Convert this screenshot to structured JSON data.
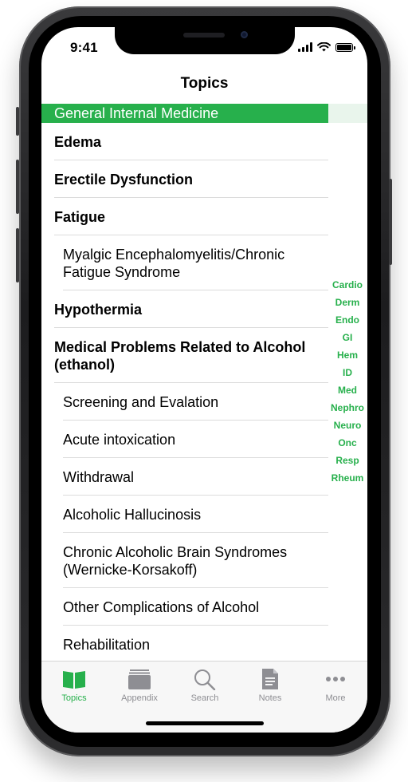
{
  "status_bar": {
    "time": "9:41"
  },
  "nav": {
    "title": "Topics"
  },
  "section": {
    "header": "General Internal Medicine"
  },
  "rows": [
    {
      "label": "Edema",
      "style": "bold"
    },
    {
      "label": "Erectile Dysfunction",
      "style": "bold"
    },
    {
      "label": "Fatigue",
      "style": "bold"
    },
    {
      "label": "Myalgic Encephalomyelitis/Chronic Fatigue Syndrome",
      "style": "sub"
    },
    {
      "label": "Hypothermia",
      "style": "bold"
    },
    {
      "label": "Medical Problems Related to Alcohol (ethanol)",
      "style": "bold"
    },
    {
      "label": "Screening and Evalation",
      "style": "sub"
    },
    {
      "label": "Acute intoxication",
      "style": "sub"
    },
    {
      "label": "Withdrawal",
      "style": "sub"
    },
    {
      "label": "Alcoholic Hallucinosis",
      "style": "sub"
    },
    {
      "label": "Chronic Alcoholic Brain Syndromes (Wernicke-Korsakoff)",
      "style": "sub"
    },
    {
      "label": "Other Complications of Alcohol",
      "style": "sub"
    },
    {
      "label": "Rehabilitation",
      "style": "sub"
    }
  ],
  "index": [
    "Cardio",
    "Derm",
    "Endo",
    "GI",
    "Hem",
    "ID",
    "Med",
    "Nephro",
    "Neuro",
    "Onc",
    "Resp",
    "Rheum"
  ],
  "tabs": [
    {
      "label": "Topics",
      "icon": "open-book-icon",
      "active": true
    },
    {
      "label": "Appendix",
      "icon": "archive-box-icon",
      "active": false
    },
    {
      "label": "Search",
      "icon": "magnifier-icon",
      "active": false
    },
    {
      "label": "Notes",
      "icon": "note-document-icon",
      "active": false
    },
    {
      "label": "More",
      "icon": "ellipsis-icon",
      "active": false
    }
  ],
  "colors": {
    "accent": "#27b04c",
    "inactive": "#8e8e93"
  }
}
